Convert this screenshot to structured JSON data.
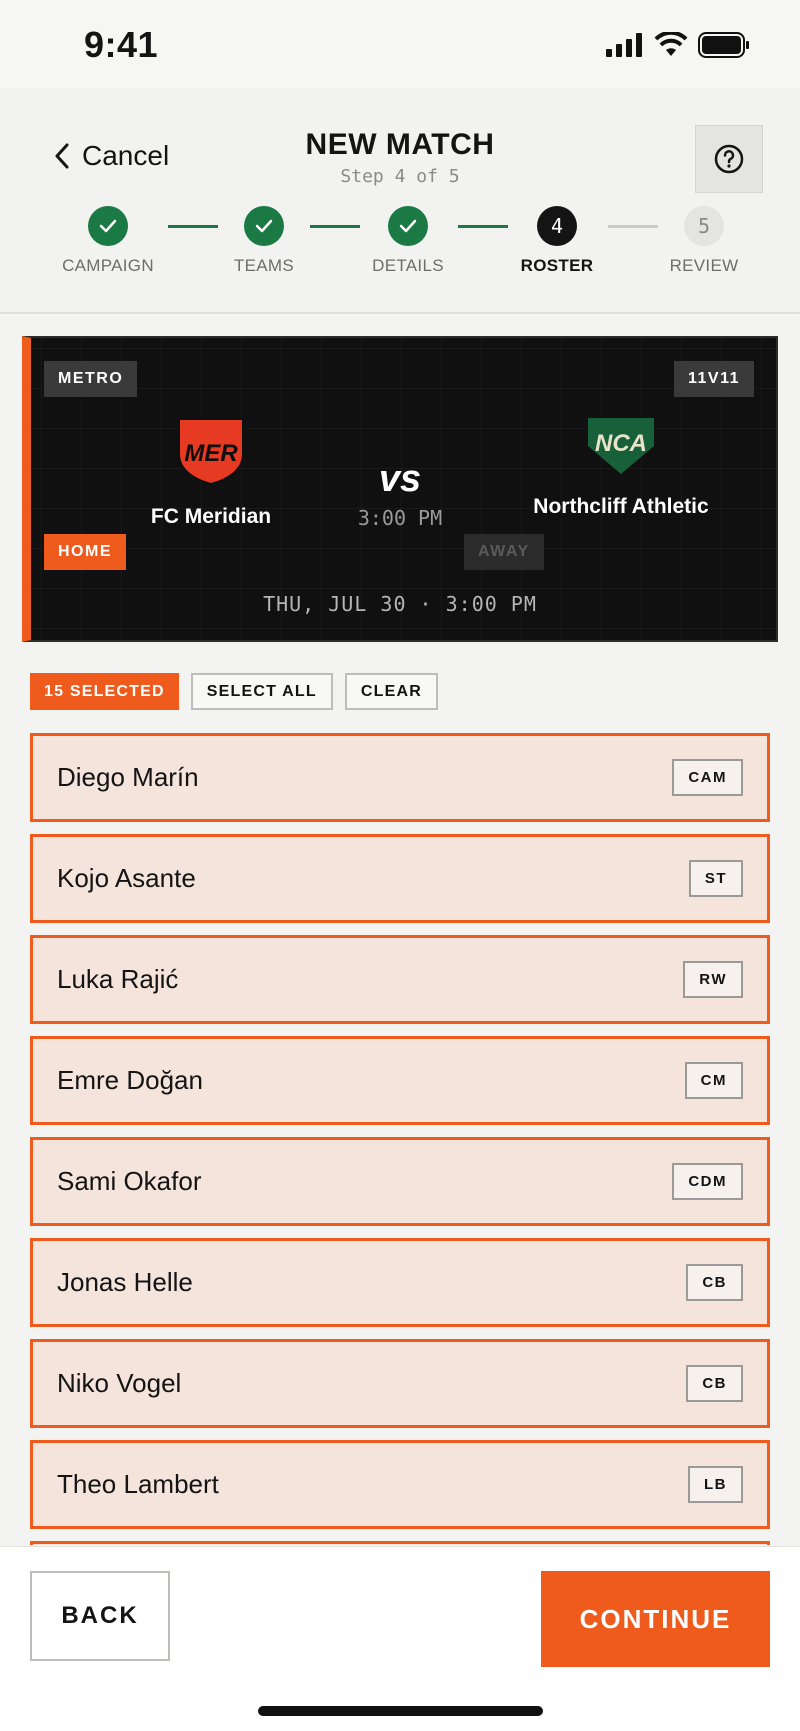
{
  "status_bar": {
    "time": "9:41"
  },
  "header": {
    "cancel_label": "Cancel",
    "title": "NEW MATCH",
    "subtitle": "Step 4 of 5",
    "steps": [
      {
        "label": "CAMPAIGN",
        "state": "done",
        "number": "1"
      },
      {
        "label": "TEAMS",
        "state": "done",
        "number": "2"
      },
      {
        "label": "DETAILS",
        "state": "done",
        "number": "3"
      },
      {
        "label": "ROSTER",
        "state": "active",
        "number": "4"
      },
      {
        "label": "REVIEW",
        "state": "todo",
        "number": "5"
      }
    ]
  },
  "match": {
    "league": "METRO",
    "format": "11V11",
    "home": {
      "abbr": "MER",
      "name": "FC Meridian",
      "tag": "HOME",
      "color": "#e63a22"
    },
    "away": {
      "abbr": "NCA",
      "name": "Northcliff Athletic",
      "tag": "AWAY",
      "color": "#17603a"
    },
    "vs": "vs",
    "time": "3:00 PM",
    "date": "THU, JUL 30 · 3:00 PM"
  },
  "selection": {
    "count_label": "15 SELECTED",
    "select_all_label": "SELECT ALL",
    "clear_label": "CLEAR"
  },
  "players": [
    {
      "name": "Diego Marín",
      "position": "CAM",
      "selected": true
    },
    {
      "name": "Kojo Asante",
      "position": "ST",
      "selected": true
    },
    {
      "name": "Luka Rajić",
      "position": "RW",
      "selected": true
    },
    {
      "name": "Emre Doğan",
      "position": "CM",
      "selected": true
    },
    {
      "name": "Sami Okafor",
      "position": "CDM",
      "selected": true
    },
    {
      "name": "Jonas Helle",
      "position": "CB",
      "selected": true
    },
    {
      "name": "Niko Vogel",
      "position": "CB",
      "selected": true
    },
    {
      "name": "Theo Lambert",
      "position": "LB",
      "selected": true
    }
  ],
  "footer": {
    "back_label": "BACK",
    "continue_label": "CONTINUE"
  },
  "colors": {
    "accent": "#ef5b1c",
    "success": "#1b7a43",
    "dark": "#101010"
  }
}
